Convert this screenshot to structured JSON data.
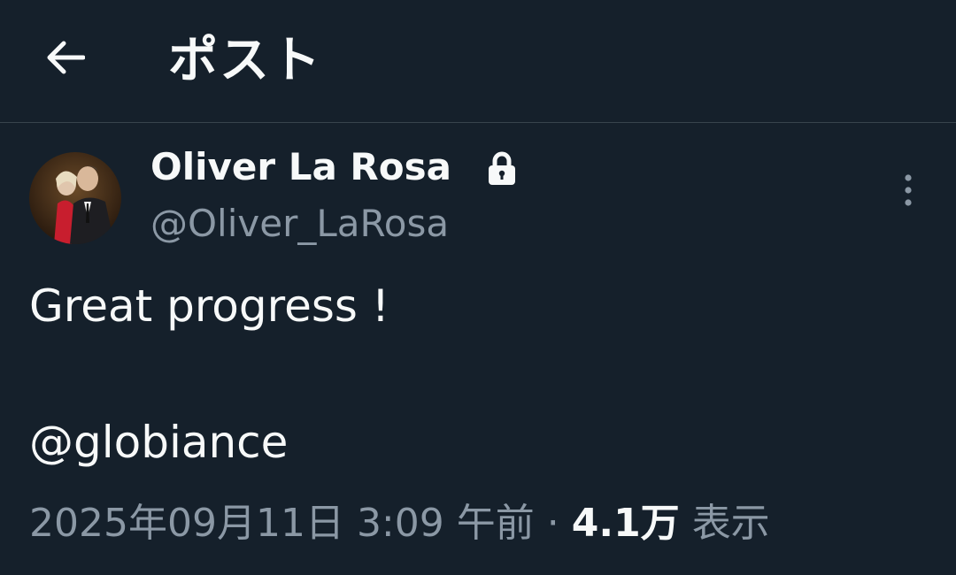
{
  "header": {
    "title": "ポスト"
  },
  "author": {
    "display_name": "Oliver La Rosa",
    "handle": "@Oliver_LaRosa"
  },
  "tweet": {
    "text": "Great progress !",
    "mention": "@globiance"
  },
  "meta": {
    "timestamp": "2025年09月11日 3:09 午前",
    "separator": "·",
    "views_count": "4.1万",
    "views_label": "表示"
  },
  "icons": {
    "back": "arrow-left-icon",
    "lock": "lock-icon",
    "more": "more-vertical-icon"
  },
  "colors": {
    "background": "#15202b",
    "primary_text": "#f7f9f9",
    "secondary_text": "#8b98a5",
    "divider": "#38444d"
  }
}
